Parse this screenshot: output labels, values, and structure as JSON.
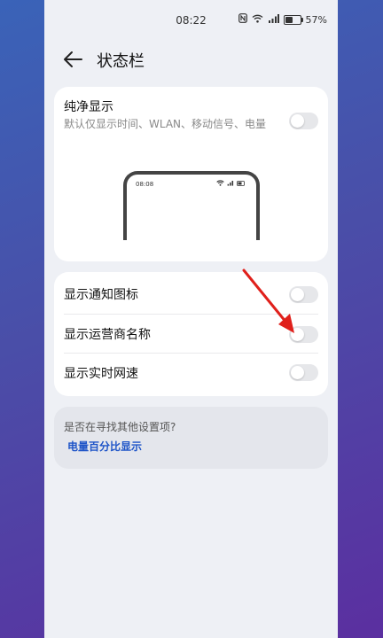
{
  "status_bar": {
    "time": "08:22",
    "battery_text": "57%",
    "battery_level": 0.57
  },
  "header": {
    "title": "状态栏"
  },
  "clean_display": {
    "title": "纯净显示",
    "description": "默认仅显示时间、WLAN、移动信号、电量",
    "enabled": false,
    "preview_time": "08:08"
  },
  "settings": [
    {
      "label": "显示通知图标",
      "enabled": false
    },
    {
      "label": "显示运营商名称",
      "enabled": false
    },
    {
      "label": "显示实时网速",
      "enabled": false
    }
  ],
  "suggestion": {
    "question": "是否在寻找其他设置项?",
    "link": "电量百分比显示"
  },
  "colors": {
    "link": "#1f55c8",
    "annotation_arrow": "#e0201b",
    "toggle_off": "#e6e7ea"
  }
}
